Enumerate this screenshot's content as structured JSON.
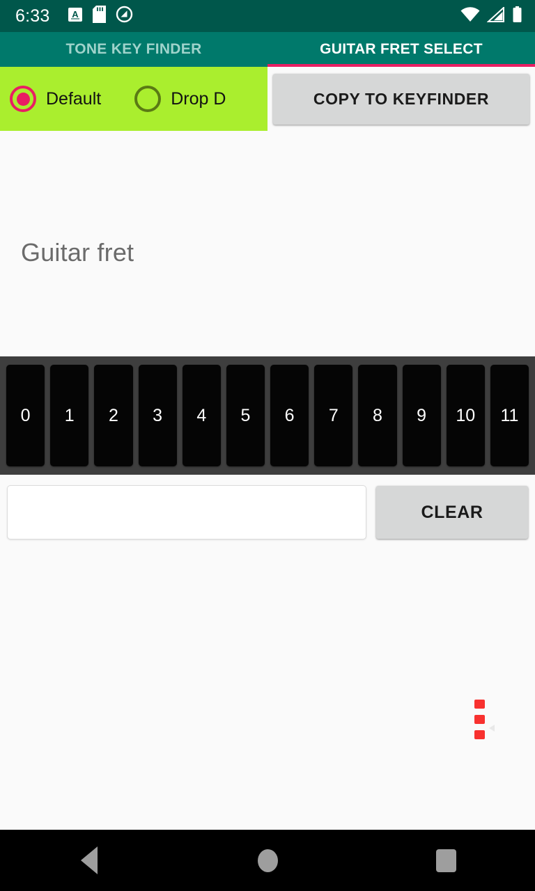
{
  "status_bar": {
    "time": "6:33",
    "left_icons": [
      "letter-a-badge-icon",
      "sd-card-icon",
      "do-not-disturb-icon"
    ],
    "right_icons": [
      "wifi-icon",
      "cell-signal-icon",
      "battery-icon"
    ],
    "background_color": "#00574b"
  },
  "tabs": {
    "items": [
      {
        "label": "TONE KEY FINDER",
        "active": false
      },
      {
        "label": "GUITAR FRET SELECT",
        "active": true
      }
    ],
    "indicator_color": "#e91e63",
    "bar_color": "#00796b",
    "active_text_color": "#ffffff",
    "inactive_text_color": "#9fd3cb"
  },
  "tuning": {
    "panel_color": "#aaee2e",
    "options": [
      {
        "label": "Default",
        "selected": true
      },
      {
        "label": "Drop D",
        "selected": false
      }
    ],
    "selected_color": "#e91e63",
    "unselected_color": "#5a7a14"
  },
  "actions": {
    "copy_label": "COPY TO KEYFINDER",
    "clear_label": "CLEAR",
    "button_color": "#d6d7d7"
  },
  "main": {
    "section_label": "Guitar fret",
    "label_color": "#6b6b6b",
    "background_color": "#fafafa"
  },
  "fretboard": {
    "strip_color": "#3e3e3e",
    "button_color": "#050505",
    "button_text_color": "#ffffff",
    "frets": [
      "0",
      "1",
      "2",
      "3",
      "4",
      "5",
      "6",
      "7",
      "8",
      "9",
      "10",
      "11"
    ]
  },
  "fret_input": {
    "value": "",
    "placeholder": ""
  },
  "footer_marks": {
    "dot_color": "#f8312f",
    "dot_count": 3
  },
  "nav_bar": {
    "buttons": [
      "back-icon",
      "home-icon",
      "recents-icon"
    ],
    "icon_color": "#9e9e9e",
    "background_color": "#000000"
  }
}
